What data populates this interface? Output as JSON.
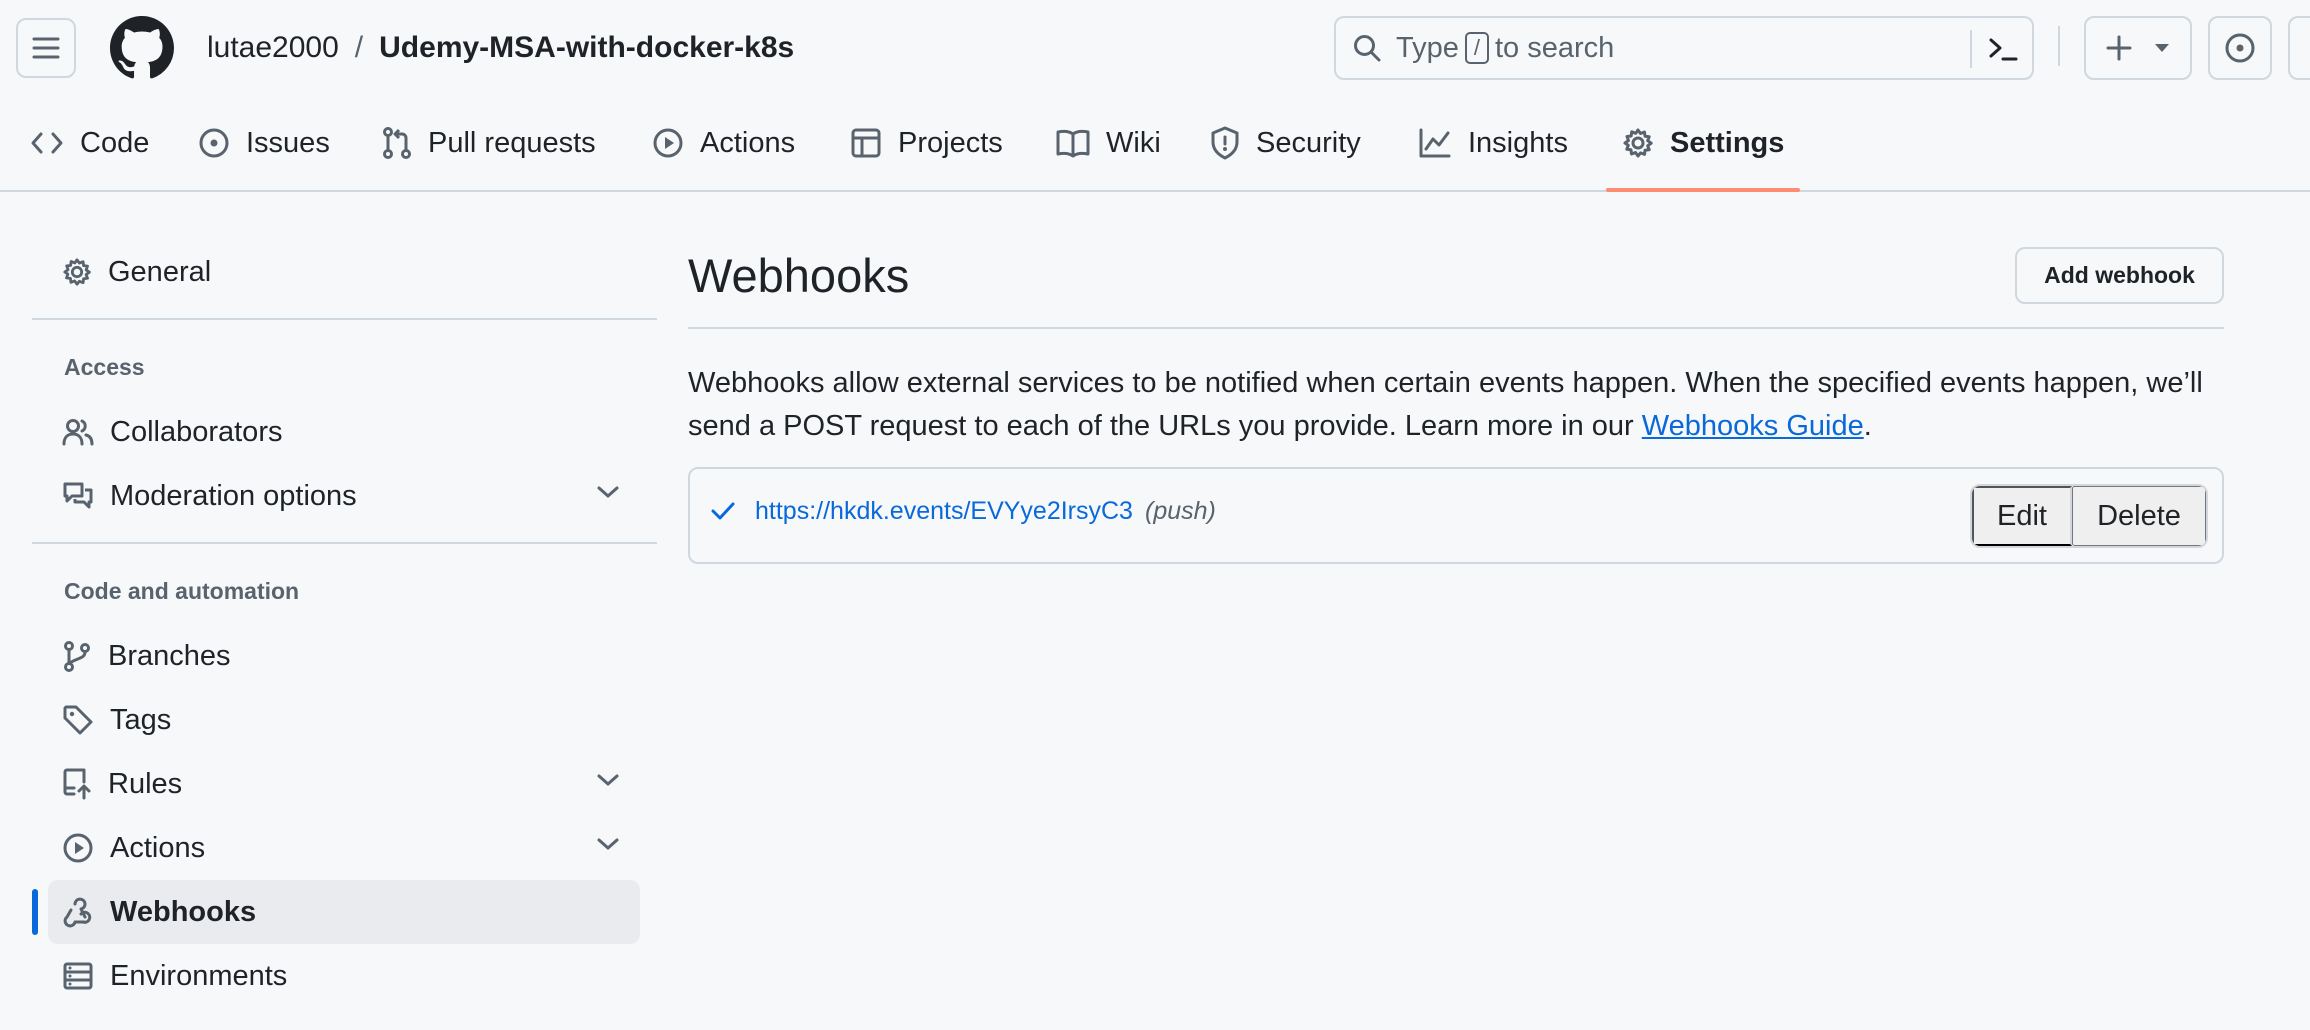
{
  "header": {
    "owner": "lutae2000",
    "separator": "/",
    "repo": "Udemy-MSA-with-docker-k8s",
    "search": {
      "before_key": "Type",
      "key": "/",
      "after_key": "to search"
    },
    "icons": [
      "hamburger-icon",
      "github-logo-icon",
      "search-icon",
      "command-palette-icon",
      "plus-icon",
      "triangle-down-icon",
      "issue-opened-icon"
    ]
  },
  "tabs": [
    {
      "label": "Code",
      "icon": "code-icon"
    },
    {
      "label": "Issues",
      "icon": "issue-opened-icon"
    },
    {
      "label": "Pull requests",
      "icon": "git-pull-request-icon"
    },
    {
      "label": "Actions",
      "icon": "play-icon"
    },
    {
      "label": "Projects",
      "icon": "table-icon"
    },
    {
      "label": "Wiki",
      "icon": "book-icon"
    },
    {
      "label": "Security",
      "icon": "shield-icon"
    },
    {
      "label": "Insights",
      "icon": "graph-icon"
    },
    {
      "label": "Settings",
      "icon": "gear-icon",
      "active": true
    }
  ],
  "sidebar": {
    "general": "General",
    "access_heading": "Access",
    "access_items": [
      {
        "label": "Collaborators",
        "icon": "people-icon"
      },
      {
        "label": "Moderation options",
        "icon": "comment-discussion-icon",
        "expandable": true
      }
    ],
    "code_heading": "Code and automation",
    "code_items": [
      {
        "label": "Branches",
        "icon": "git-branch-icon"
      },
      {
        "label": "Tags",
        "icon": "tag-icon"
      },
      {
        "label": "Rules",
        "icon": "repo-push-icon",
        "expandable": true
      },
      {
        "label": "Actions",
        "icon": "play-icon",
        "expandable": true
      },
      {
        "label": "Webhooks",
        "icon": "webhook-icon",
        "selected": true
      },
      {
        "label": "Environments",
        "icon": "server-icon"
      }
    ]
  },
  "main": {
    "title": "Webhooks",
    "add_button": "Add webhook",
    "description_text": "Webhooks allow external services to be notified when certain events happen. When the specified events happen, we’ll send a POST request to each of the URLs you provide. Learn more in our ",
    "guide_link": "Webhooks Guide",
    "description_end": ".",
    "webhooks": [
      {
        "url": "https://hkdk.events/EVYye2Irsy​C3",
        "events": "(push)",
        "status": "success"
      }
    ],
    "edit_label": "Edit",
    "delete_label": "Delete"
  },
  "colors": {
    "accent": "#0969da",
    "tab_underline": "#fd8c73",
    "border": "#d0d7de",
    "muted": "#59636e",
    "background": "#f6f8fa"
  }
}
